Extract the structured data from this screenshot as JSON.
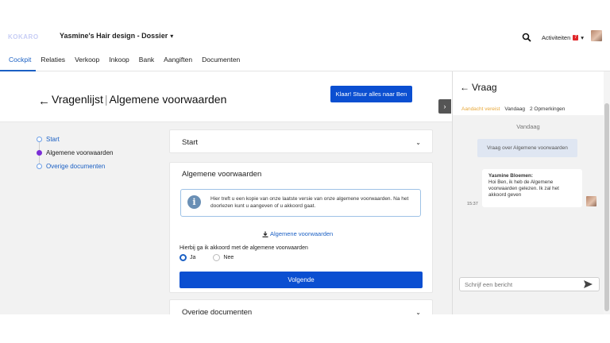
{
  "header": {
    "logo_text": "KOKARO",
    "dossier_title": "Yasmine's Hair design - Dossier",
    "activiteiten_label": "Activiteiten",
    "activiteiten_count": "7"
  },
  "nav": {
    "items": [
      {
        "label": "Cockpit"
      },
      {
        "label": "Relaties"
      },
      {
        "label": "Verkoop"
      },
      {
        "label": "Inkoop"
      },
      {
        "label": "Bank"
      },
      {
        "label": "Aangiften"
      },
      {
        "label": "Documenten"
      }
    ]
  },
  "page": {
    "title_left": "Vragenlijst",
    "title_sep": "|",
    "title_right": "Algemene voorwaarden",
    "submit_label": "Klaar! Stuur alles naar Ben"
  },
  "stepper": {
    "steps": [
      {
        "label": "Start"
      },
      {
        "label": "Algemene voorwaarden"
      },
      {
        "label": "Overige documenten"
      }
    ]
  },
  "cards": {
    "start_title": "Start",
    "av_title": "Algemene voorwaarden",
    "info_text": "Hier treft u een kopie van onze laatste versie van onze algemene voorwaarden. Na het doorlezen kunt u aangeven of u akkoord gaat.",
    "download_label": "Algemene voorwaarden",
    "question": "Hierbij ga ik akkoord met de algemene voorwaarden",
    "option_yes": "Ja",
    "option_no": "Nee",
    "next_label": "Volgende",
    "overige_title": "Overige documenten"
  },
  "panel": {
    "title": "Vraag",
    "status": "Aandacht vereist",
    "date": "Vandaag",
    "remarks": "2 Opmerkingen",
    "day_separator": "Vandaag",
    "question_bubble": "Vraag over Algemene voorwaarden",
    "message_sender": "Yasmine Bloemen:",
    "message_text": "Hoi Ben, ik heb de Algemene voorwaarden gelezen. Ik zal het akkoord geven",
    "message_time": "15:37",
    "input_placeholder": "Schrijf een bericht"
  },
  "colors": {
    "primary": "#0b4fd1",
    "link": "#1b60c4",
    "warning": "#e8a83a",
    "step_current": "#7b2fd6"
  }
}
